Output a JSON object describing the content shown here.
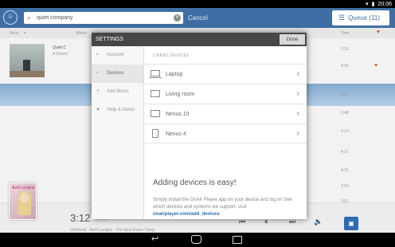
{
  "status_bar": {
    "time": "20:06"
  },
  "topbar": {
    "search_value": "quiet company",
    "cancel_label": "Cancel",
    "queue_label": "Queue (11)"
  },
  "columns": {
    "artist": "Artist",
    "album": "Album",
    "time": "Time"
  },
  "background_album": {
    "title": "Quiet C",
    "artist": "A Desert"
  },
  "background_rows": [
    "2:26",
    "4:26",
    "3:21",
    "3:48",
    "4:19",
    "4:21",
    "4:21",
    "3:50",
    "3:52"
  ],
  "dialog": {
    "title": "SETTINGS",
    "done_label": "Done",
    "sidebar": [
      {
        "icon": "person-icon",
        "label": "Account"
      },
      {
        "icon": "devices-icon",
        "label": "Devices"
      },
      {
        "icon": "plus-icon",
        "label": "Add Music"
      },
      {
        "icon": "info-icon",
        "label": "Help & About"
      }
    ],
    "section_header": "LINKED DEVICES",
    "devices": [
      {
        "name": "Laptop",
        "icon": "laptop-icon"
      },
      {
        "name": "Living room",
        "icon": "monitor-icon"
      },
      {
        "name": "Nexus 10",
        "icon": "tv-icon"
      },
      {
        "name": "Nexus 4",
        "icon": "tablet-icon"
      }
    ],
    "info_title": "Adding devices is easy!",
    "info_body": "Simply install the OnAir Player app on your device and log in! See which devices and systems we support; visit ",
    "info_link": "onairplayer.com/add_devices"
  },
  "player": {
    "current_time": "3:12",
    "total_time": "3:35",
    "now_playing": "Girlfriend · Avril Lavigne · The Best Damn Thing",
    "cover_title": "Avril Lavigne"
  }
}
